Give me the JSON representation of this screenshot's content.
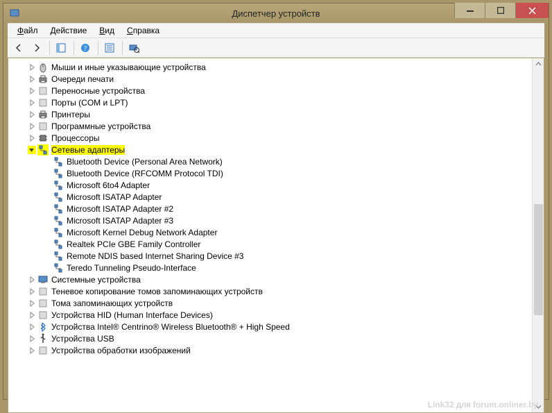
{
  "title": "Диспетчер устройств",
  "menu": {
    "file": "Файл",
    "action": "Действие",
    "view": "Вид",
    "help": "Справка"
  },
  "tree": {
    "categories": [
      {
        "label": "Мыши и иные указывающие устройства",
        "expanded": false,
        "icon": "mouse-icon"
      },
      {
        "label": "Очереди печати",
        "expanded": false,
        "icon": "printer-icon"
      },
      {
        "label": "Переносные устройства",
        "expanded": false,
        "icon": "portable-icon"
      },
      {
        "label": "Порты (COM и LPT)",
        "expanded": false,
        "icon": "port-icon"
      },
      {
        "label": "Принтеры",
        "expanded": false,
        "icon": "printer-icon"
      },
      {
        "label": "Программные устройства",
        "expanded": false,
        "icon": "software-icon"
      },
      {
        "label": "Процессоры",
        "expanded": false,
        "icon": "cpu-icon"
      },
      {
        "label": "Сетевые адаптеры",
        "expanded": true,
        "highlight": true,
        "icon": "network-icon",
        "children": [
          "Bluetooth Device (Personal Area Network)",
          "Bluetooth Device (RFCOMM Protocol TDI)",
          "Microsoft 6to4 Adapter",
          "Microsoft ISATAP Adapter",
          "Microsoft ISATAP Adapter #2",
          "Microsoft ISATAP Adapter #3",
          "Microsoft Kernel Debug Network Adapter",
          "Realtek PCIe GBE Family Controller",
          "Remote NDIS based Internet Sharing Device #3",
          "Teredo Tunneling Pseudo-Interface"
        ]
      },
      {
        "label": "Системные устройства",
        "expanded": false,
        "icon": "system-icon"
      },
      {
        "label": "Теневое копирование томов запоминающих устройств",
        "expanded": false,
        "icon": "shadow-icon"
      },
      {
        "label": "Тома запоминающих устройств",
        "expanded": false,
        "icon": "volume-icon"
      },
      {
        "label": "Устройства HID (Human Interface Devices)",
        "expanded": false,
        "icon": "hid-icon"
      },
      {
        "label": "Устройства Intel® Centrino® Wireless Bluetooth® + High Speed",
        "expanded": false,
        "icon": "bluetooth-icon"
      },
      {
        "label": "Устройства USB",
        "expanded": false,
        "icon": "usb-icon"
      },
      {
        "label": "Устройства обработки изображений",
        "expanded": false,
        "icon": "imaging-icon"
      }
    ]
  },
  "watermark": {
    "author": "Link32",
    "for": "для",
    "site": "forum.onliner.by"
  }
}
